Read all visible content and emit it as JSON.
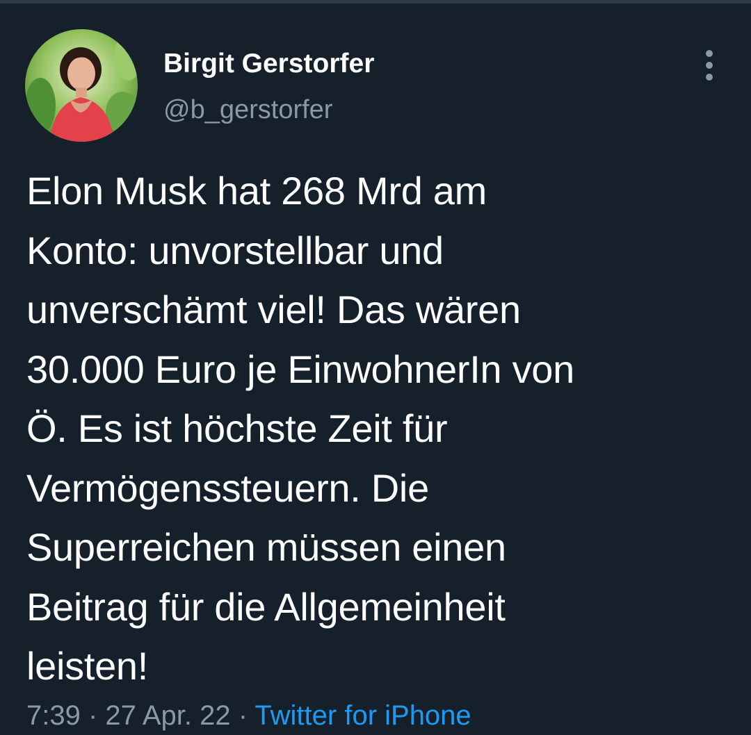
{
  "tweet": {
    "author": {
      "name": "Birgit Gerstorfer",
      "handle": "@b_gerstorfer"
    },
    "text": "Elon Musk hat 268 Mrd am\nKonto: unvorstellbar und\nunverschämt viel! Das wären\n30.000 Euro je EinwohnerIn von\nÖ. Es ist höchste Zeit für\nVermögenssteuern. Die\nSuperreichen müssen einen\nBeitrag für die Allgemeinheit\nleisten!",
    "time": "7:39",
    "date": "27 Apr. 22",
    "separator": "·",
    "source": "Twitter for iPhone"
  },
  "icons": {
    "more": "more-vertical-icon"
  },
  "colors": {
    "background": "#15202b",
    "text": "#ffffff",
    "secondary": "#8b98a5",
    "link": "#1d9bf0"
  }
}
